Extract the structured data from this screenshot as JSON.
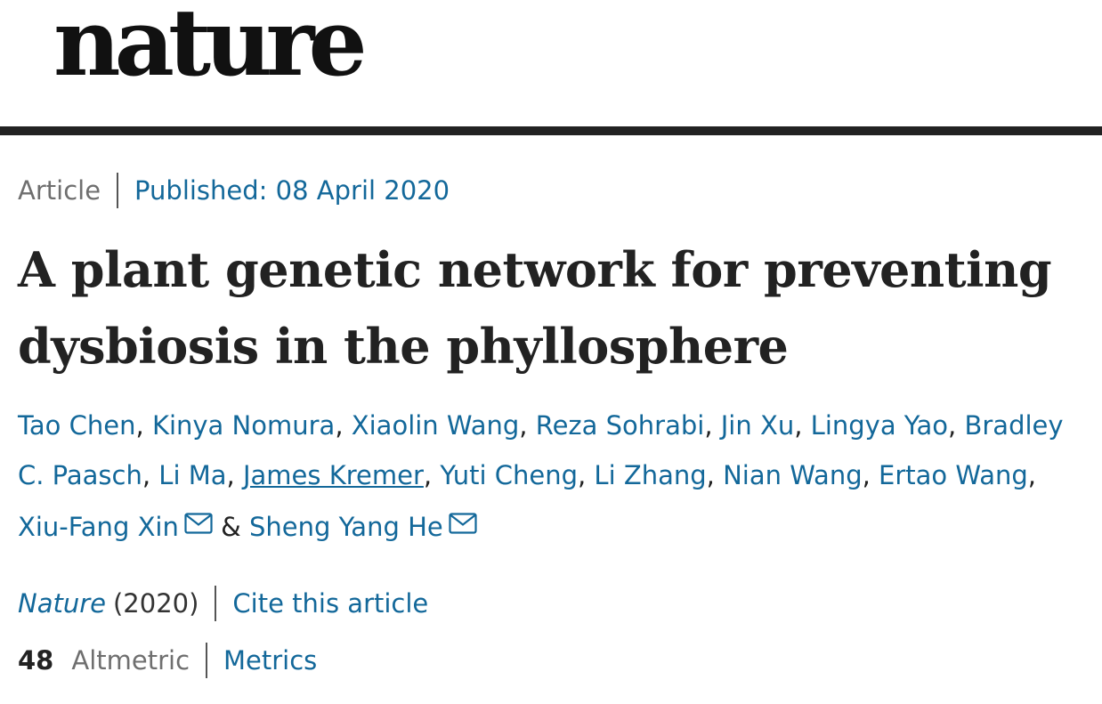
{
  "header": {
    "logo": "nature"
  },
  "article": {
    "type": "Article",
    "published": "Published: 08 April 2020",
    "title": "A plant genetic network for preventing dysbiosis in the phyllosphere"
  },
  "authors": [
    "Tao Chen",
    "Kinya Nomura",
    "Xiaolin Wang",
    "Reza Sohrabi",
    "Jin Xu",
    "Lingya Yao",
    "Bradley C. Paasch",
    "Li Ma",
    "James Kremer",
    "Yuti Cheng",
    "Li Zhang",
    "Nian Wang",
    "Ertao Wang",
    "Xiu-Fang Xin",
    "Sheng Yang He"
  ],
  "author_separators": {
    "comma": ", ",
    "ampersand": " & "
  },
  "icons": {
    "email": "mail-icon"
  },
  "citation": {
    "journal": "Nature",
    "year": "(2020)",
    "cite_link": "Cite this article"
  },
  "metrics": {
    "count": "48",
    "altmetric": "Altmetric",
    "metrics_link": "Metrics"
  },
  "colors": {
    "link": "#13689a",
    "text": "#222222",
    "muted": "#6f6f6f",
    "rule": "#222222"
  }
}
